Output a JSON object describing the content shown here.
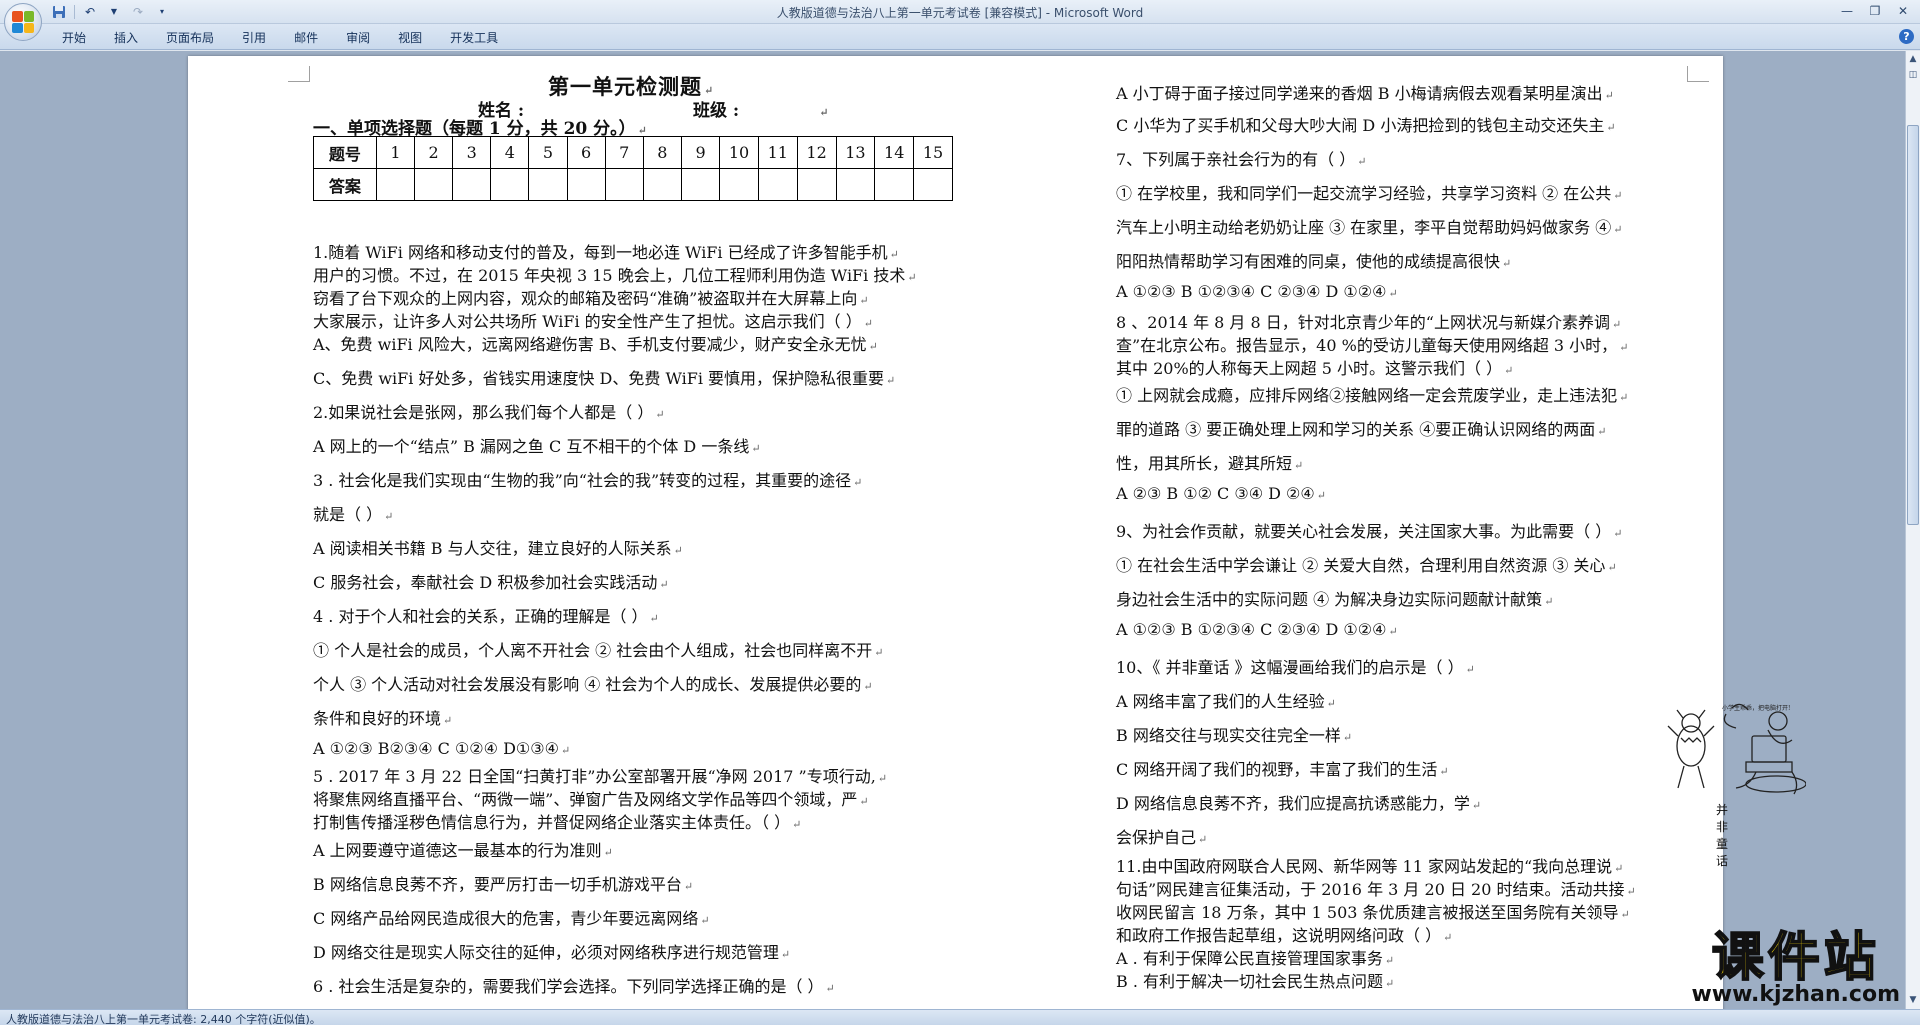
{
  "window": {
    "title": "人教版道德与法治八上第一单元考试卷 [兼容模式] - Microsoft Word"
  },
  "ribbon": {
    "tabs": [
      "开始",
      "插入",
      "页面布局",
      "引用",
      "邮件",
      "审阅",
      "视图",
      "开发工具"
    ]
  },
  "status": {
    "text": "人教版道德与法治八上第一单元考试卷: 2,440 个字符(近似值)。"
  },
  "document": {
    "title": "第一单元检测题",
    "name_label": "姓名 :",
    "class_label": "班级 :",
    "section1": "一、单项选择题（每题 1 分，共 20 分。）",
    "table": {
      "row1_head": "题号",
      "numbers": [
        "1",
        "2",
        "3",
        "4",
        "5",
        "6",
        "7",
        "8",
        "9",
        "10",
        "11",
        "12",
        "13",
        "14",
        "15"
      ],
      "row2_head": "答案"
    },
    "left_lines": [
      "1.随着 WiFi 网络和移动支付的普及，每到一地必连 WiFi 已经成了许多智能手机",
      "用户的习惯。不过，在 2015 年央视 3 15 晚会上，几位工程师利用伪造 WiFi 技术",
      "窃看了台下观众的上网内容，观众的邮箱及密码“准确”被盗取并在大屏幕上向",
      "大家展示，让许多人对公共场所 WiFi 的安全性产生了担忧。这启示我们（   ）",
      "A、免费 wiFi 风险大，远离网络避伤害    B、手机支付要减少，财产安全永无忧",
      "C、免费 wiFi 好处多，省钱实用速度快   D、免费 WiFi 要慎用，保护隐私很重要",
      "2.如果说社会是张网，那么我们每个人都是（   ）",
      "A 网上的一个“结点”    B 漏网之鱼     C 互不相干的个体     D 一条线",
      "3 . 社会化是我们实现由“生物的我”向“社会的我”转变的过程，其重要的途径",
      "就是（   ）",
      "A 阅读相关书籍                    B 与人交往，建立良好的人际关系",
      "C 服务社会，奉献社会              D 积极参加社会实践活动",
      "4 . 对于个人和社会的关系，正确的理解是（   ）",
      "① 个人是社会的成员，个人离不开社会 ② 社会由个人组成，社会也同样离不开",
      "个人 ③ 个人活动对社会发展没有影响 ④ 社会为个人的成长、发展提供必要的",
      "条件和良好的环境",
      "A  ①②③     B②③④     C ①②④      D①③④",
      "5 . 2017 年 3 月 22 日全国“扫黄打非”办公室部署开展“净网 2017 ”专项行动,",
      "将聚焦网络直播平台、“两微一端”、弹窗广告及网络文学作品等四个领域，严",
      "打制售传播淫秽色情信息行为，并督促网络企业落实主体责任。（   ）",
      "A 上网要遵守道德这一最基本的行为准则",
      "B 网络信息良莠不齐，要严厉打击一切手机游戏平台",
      "C 网络产品给网民造成很大的危害，青少年要远离网络",
      "D 网络交往是现实人际交往的延伸，必须对网络秩序进行规范管理",
      "6 . 社会生活是复杂的，需要我们学会选择。下列同学选择正确的是（   ）"
    ],
    "right_lines": [
      "A 小丁碍于面子接过同学递来的香烟  B 小梅请病假去观看某明星演出",
      "C 小华为了买手机和父母大吵大闹  D 小涛把捡到的钱包主动交还失主",
      "7、下列属于亲社会行为的有（     ）",
      "① 在学校里，我和同学们一起交流学习经验，共享学习资料 ② 在公共",
      "汽车上小明主动给老奶奶让座 ③ 在家里，李平自觉帮助妈妈做家务 ④",
      "阳阳热情帮助学习有困难的同桌，使他的成绩提高很快",
      "A ①②③    B ①②③④     C ②③④    D ①②④",
      "8 、2014 年 8 月 8 日，针对北京青少年的“上网状况与新媒介素养调",
      "查”在北京公布。报告显示，40 %的受访儿童每天使用网络超 3 小时，",
      "其中 20%的人称每天上网超 5 小时。这警示我们（     ）",
      "① 上网就会成瘾，应排斥网络②接触网络一定会荒废学业，走上违法犯",
      "罪的道路 ③ 要正确处理上网和学习的关系 ④要正确认识网络的两面",
      "性，用其所长，避其所短",
      "A ②③      B ①②       C ③④       D ②④",
      "9、为社会作贡献，就要关心社会发展，关注国家大事。为此需要（   ）",
      "① 在社会生活中学会谦让 ② 关爱大自然，合理利用自然资源 ③ 关心",
      "身边社会生活中的实际问题 ④ 为解决身边实际问题献计献策",
      "A ①②③     B ①②③④    C ②③④    D ①②④",
      "10、《 并非童话 》这幅漫画给我们的启示是（      ）",
      "A 网络丰富了我们的人生经验",
      "B 网络交往与现实交往完全一样",
      "C 网络开阔了我们的视野，丰富了我们的生活",
      "D 网络信息良莠不齐，我们应提高抗诱惑能力，学",
      "  会保护自己",
      "11.由中国政府网联合人民网、新华网等 11 家网站发起的“我向总理说",
      "句话”网民建言征集活动，于 2016 年 3 月 20 日 20 时结束。活动共接",
      "收网民留言 18 万条，其中 1 503 条优质建言被报送至国务院有关领导",
      "和政府工作报告起草组，这说明网络问政（     ）",
      "A . 有利于保障公民直接管理国家事务",
      "B . 有利于解决一切社会民生热点问题"
    ],
    "cartoon_caption": "并非童话",
    "cartoon_bubble": "小学生乖乖，把电脑打开!"
  },
  "watermark": {
    "main": "课件站",
    "url": "www.kjzhan.com"
  },
  "colors": {
    "ribbon": "#d6e2f0",
    "workspace": "#9daec4",
    "watermark_yellow": "#f5d60a"
  }
}
